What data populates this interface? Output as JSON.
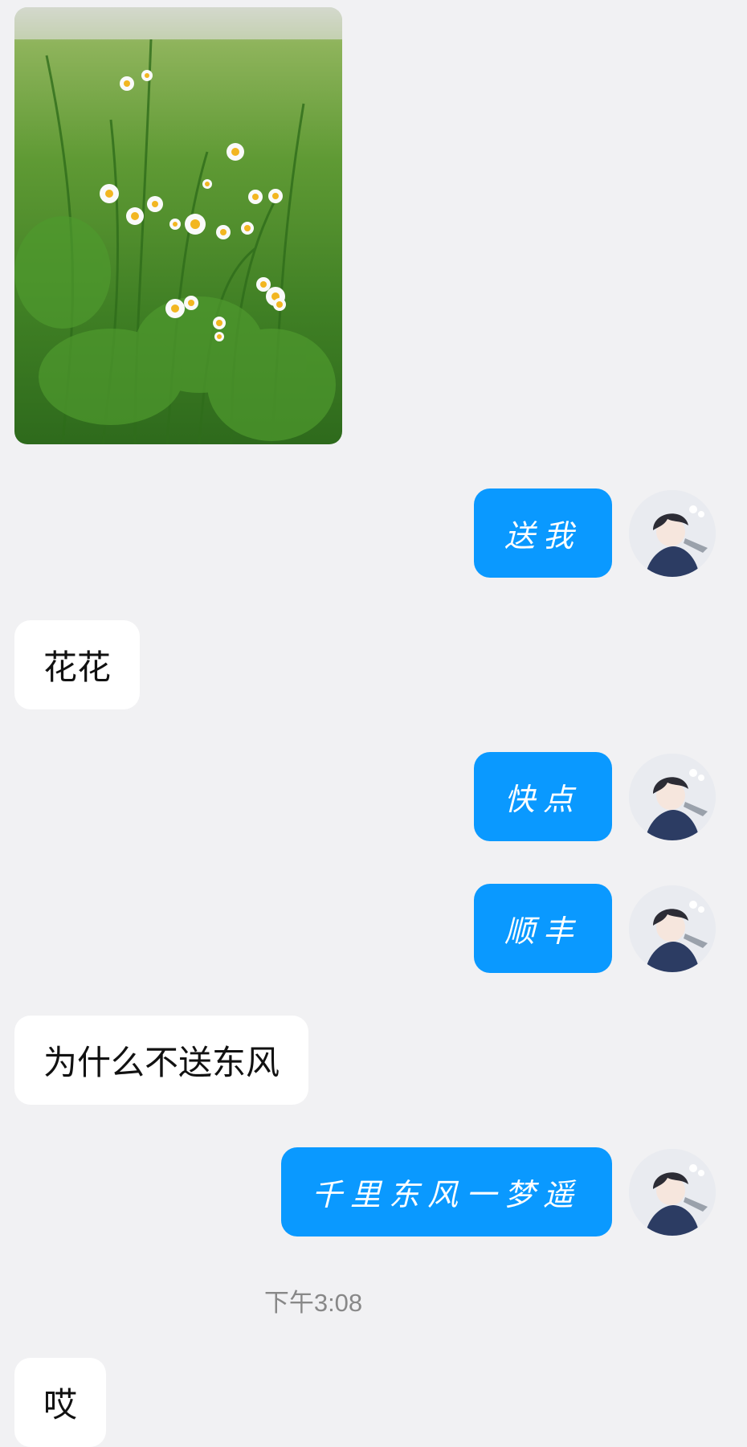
{
  "conversation": {
    "messages": [
      {
        "side": "in",
        "type": "image",
        "alt": "photo of white daisy-like wildflowers in green grass"
      },
      {
        "side": "out",
        "text": "送我"
      },
      {
        "side": "in",
        "text": "花花"
      },
      {
        "side": "out",
        "text": "快点"
      },
      {
        "side": "out",
        "text": "顺丰"
      },
      {
        "side": "in",
        "text": "为什么不送东风"
      },
      {
        "side": "out",
        "text": "千里东风一梦遥"
      },
      {
        "side": "in",
        "text": "哎"
      }
    ],
    "timestamp": "下午3:08"
  },
  "colors": {
    "background": "#f1f1f3",
    "incoming_bubble": "#ffffff",
    "outgoing_bubble": "#0a99ff"
  },
  "icons": {
    "avatar": "anime-character-avatar"
  }
}
